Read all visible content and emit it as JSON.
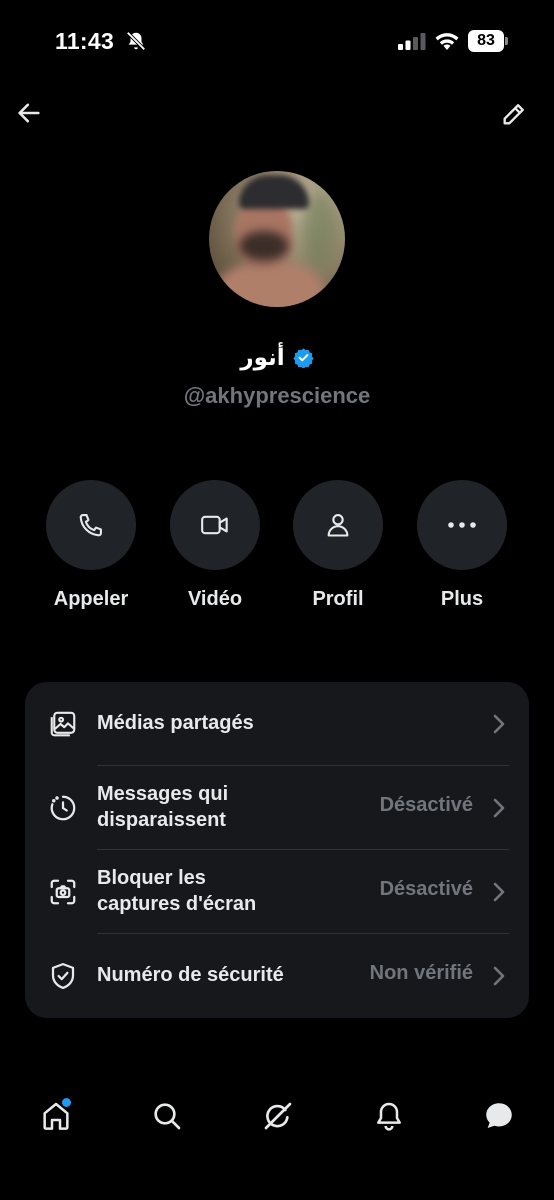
{
  "status_bar": {
    "time": "11:43",
    "battery": "83",
    "icons": [
      "bell-muted-icon",
      "cellular-signal-icon",
      "wifi-icon",
      "battery-icon"
    ]
  },
  "header": {
    "back_icon": "arrow-left-icon",
    "edit_icon": "pencil-icon"
  },
  "profile": {
    "display_name": "أنور",
    "verified": true,
    "handle": "@akhyprescience",
    "verified_color": "#1d9bf0"
  },
  "actions": [
    {
      "label": "Appeler",
      "icon": "phone-icon"
    },
    {
      "label": "Vidéo",
      "icon": "video-camera-icon"
    },
    {
      "label": "Profil",
      "icon": "person-icon"
    },
    {
      "label": "Plus",
      "icon": "more-dots-icon"
    }
  ],
  "settings": [
    {
      "title": "Médias partagés",
      "value": "",
      "icon": "shared-media-icon"
    },
    {
      "title": "Messages qui disparaissent",
      "title_line1": "Messages qui",
      "title_line2": "disparaissent",
      "value": "Désactivé",
      "icon": "timer-icon"
    },
    {
      "title": "Bloquer les captures d'écran",
      "title_line1": "Bloquer les",
      "title_line2": "captures d'écran",
      "value": "Désactivé",
      "icon": "screenshot-block-icon"
    },
    {
      "title": "Numéro de sécurité",
      "value": "Non vérifié",
      "icon": "shield-check-icon"
    }
  ],
  "bottom_nav": {
    "items": [
      "home-icon",
      "search-icon",
      "grok-icon",
      "notifications-icon",
      "messages-icon"
    ],
    "active": "messages-icon",
    "accent": "#1d9bf0"
  }
}
